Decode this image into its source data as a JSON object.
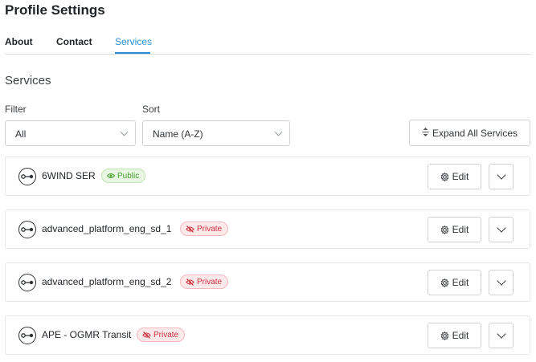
{
  "page": {
    "title": "Profile Settings"
  },
  "tabs": [
    {
      "label": "About",
      "active": false
    },
    {
      "label": "Contact",
      "active": false
    },
    {
      "label": "Services",
      "active": true
    }
  ],
  "section": {
    "title": "Services"
  },
  "filters": {
    "filter": {
      "label": "Filter",
      "value": "All"
    },
    "sort": {
      "label": "Sort",
      "value": "Name (A-Z)"
    },
    "expand_all_label": "Expand All Services"
  },
  "colors": {
    "accent": "#2a8fd6",
    "public_badge": "#43a12a",
    "private_badge": "#d0303f"
  },
  "services": [
    {
      "name": "6WIND SER",
      "visibility": "Public",
      "edit_label": "Edit",
      "icon": "service-node-icon"
    },
    {
      "name": "advanced_platform_eng_sd_1",
      "visibility": "Private",
      "edit_label": "Edit",
      "icon": "service-node-icon"
    },
    {
      "name": "advanced_platform_eng_sd_2",
      "visibility": "Private",
      "edit_label": "Edit",
      "icon": "service-node-icon"
    },
    {
      "name": "APE - OGMR Transit",
      "visibility": "Private",
      "edit_label": "Edit",
      "icon": "service-node-icon"
    }
  ]
}
